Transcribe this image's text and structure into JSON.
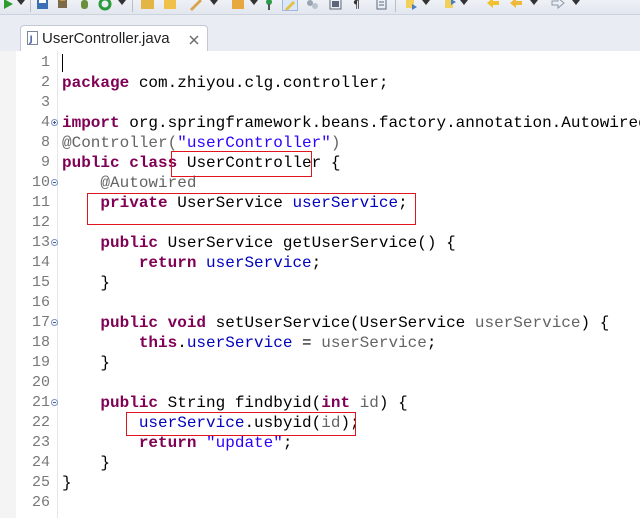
{
  "editor_tab": {
    "label": "UserController.java"
  },
  "code_lines": [
    {
      "num": "1",
      "tokens": []
    },
    {
      "num": "2",
      "tokens": [
        {
          "t": "package",
          "c": "kw"
        },
        {
          "t": " com.zhiyou.clg.controller;",
          "c": ""
        }
      ]
    },
    {
      "num": "3",
      "tokens": []
    },
    {
      "num": "4",
      "fold": "plus",
      "tokens": [
        {
          "t": "import",
          "c": "kw"
        },
        {
          "t": " org.springframework.beans.factory.annotation.Autowired;",
          "c": ""
        }
      ]
    },
    {
      "num": "8",
      "tokens": [
        {
          "t": "@Controller(",
          "c": "ann"
        },
        {
          "t": "\"userController\"",
          "c": "str"
        },
        {
          "t": ")",
          "c": "ann"
        }
      ]
    },
    {
      "num": "9",
      "tokens": [
        {
          "t": "public",
          "c": "kw"
        },
        {
          "t": " ",
          "c": ""
        },
        {
          "t": "class",
          "c": "kw"
        },
        {
          "t": " UserController {",
          "c": ""
        }
      ]
    },
    {
      "num": "10",
      "fold": "minus",
      "tokens": [
        {
          "t": "    @Autowired",
          "c": "ann"
        }
      ]
    },
    {
      "num": "11",
      "tokens": [
        {
          "t": "    ",
          "c": ""
        },
        {
          "t": "private",
          "c": "kw"
        },
        {
          "t": " UserService ",
          "c": ""
        },
        {
          "t": "userService",
          "c": "field"
        },
        {
          "t": ";",
          "c": ""
        }
      ]
    },
    {
      "num": "12",
      "tokens": []
    },
    {
      "num": "13",
      "fold": "minus",
      "tokens": [
        {
          "t": "    ",
          "c": ""
        },
        {
          "t": "public",
          "c": "kw"
        },
        {
          "t": " UserService getUserService() {",
          "c": ""
        }
      ]
    },
    {
      "num": "14",
      "tokens": [
        {
          "t": "        ",
          "c": ""
        },
        {
          "t": "return",
          "c": "kw"
        },
        {
          "t": " ",
          "c": ""
        },
        {
          "t": "userService",
          "c": "field"
        },
        {
          "t": ";",
          "c": ""
        }
      ]
    },
    {
      "num": "15",
      "tokens": [
        {
          "t": "    }",
          "c": ""
        }
      ]
    },
    {
      "num": "16",
      "tokens": []
    },
    {
      "num": "17",
      "fold": "minus",
      "tokens": [
        {
          "t": "    ",
          "c": ""
        },
        {
          "t": "public",
          "c": "kw"
        },
        {
          "t": " ",
          "c": ""
        },
        {
          "t": "void",
          "c": "kw"
        },
        {
          "t": " setUserService(UserService ",
          "c": ""
        },
        {
          "t": "userService",
          "c": "ann"
        },
        {
          "t": ") {",
          "c": ""
        }
      ]
    },
    {
      "num": "18",
      "tokens": [
        {
          "t": "        ",
          "c": ""
        },
        {
          "t": "this",
          "c": "kw"
        },
        {
          "t": ".",
          "c": ""
        },
        {
          "t": "userService",
          "c": "field"
        },
        {
          "t": " = ",
          "c": ""
        },
        {
          "t": "userService",
          "c": "ann"
        },
        {
          "t": ";",
          "c": ""
        }
      ]
    },
    {
      "num": "19",
      "tokens": [
        {
          "t": "    }",
          "c": ""
        }
      ]
    },
    {
      "num": "20",
      "tokens": []
    },
    {
      "num": "21",
      "fold": "minus",
      "tokens": [
        {
          "t": "    ",
          "c": ""
        },
        {
          "t": "public",
          "c": "kw"
        },
        {
          "t": " String findbyid(",
          "c": ""
        },
        {
          "t": "int",
          "c": "kw"
        },
        {
          "t": " ",
          "c": ""
        },
        {
          "t": "id",
          "c": "ann"
        },
        {
          "t": ") {",
          "c": ""
        }
      ]
    },
    {
      "num": "22",
      "tokens": [
        {
          "t": "        ",
          "c": ""
        },
        {
          "t": "userService",
          "c": "field"
        },
        {
          "t": ".usbyid(",
          "c": ""
        },
        {
          "t": "id",
          "c": "ann"
        },
        {
          "t": ");",
          "c": ""
        }
      ]
    },
    {
      "num": "23",
      "tokens": [
        {
          "t": "        ",
          "c": ""
        },
        {
          "t": "return",
          "c": "kw"
        },
        {
          "t": " ",
          "c": ""
        },
        {
          "t": "\"update\"",
          "c": "str"
        },
        {
          "t": ";",
          "c": ""
        }
      ]
    },
    {
      "num": "24",
      "tokens": [
        {
          "t": "    }",
          "c": ""
        }
      ]
    },
    {
      "num": "25",
      "tokens": [
        {
          "t": "}",
          "c": ""
        }
      ]
    },
    {
      "num": "26",
      "tokens": []
    }
  ],
  "toolbar_icons": [
    "run-icon",
    "save-all-icon",
    "build-icon",
    "refresh-icon",
    "open-folder-icon",
    "open-file-icon",
    "pencil-icon",
    "open-type-icon",
    "pin-icon",
    "highlight-icon",
    "mark-icon",
    "toggle-icon",
    "show-whitespace-icon",
    "block-select-icon",
    "next-annotation-icon",
    "prev-annotation-icon",
    "back-icon",
    "forward-icon"
  ],
  "colors": {
    "keyword": "#7f0055",
    "string": "#2a00ff",
    "field": "#0000c0",
    "annotation": "#646464",
    "highlight_box": "#e0161e"
  }
}
